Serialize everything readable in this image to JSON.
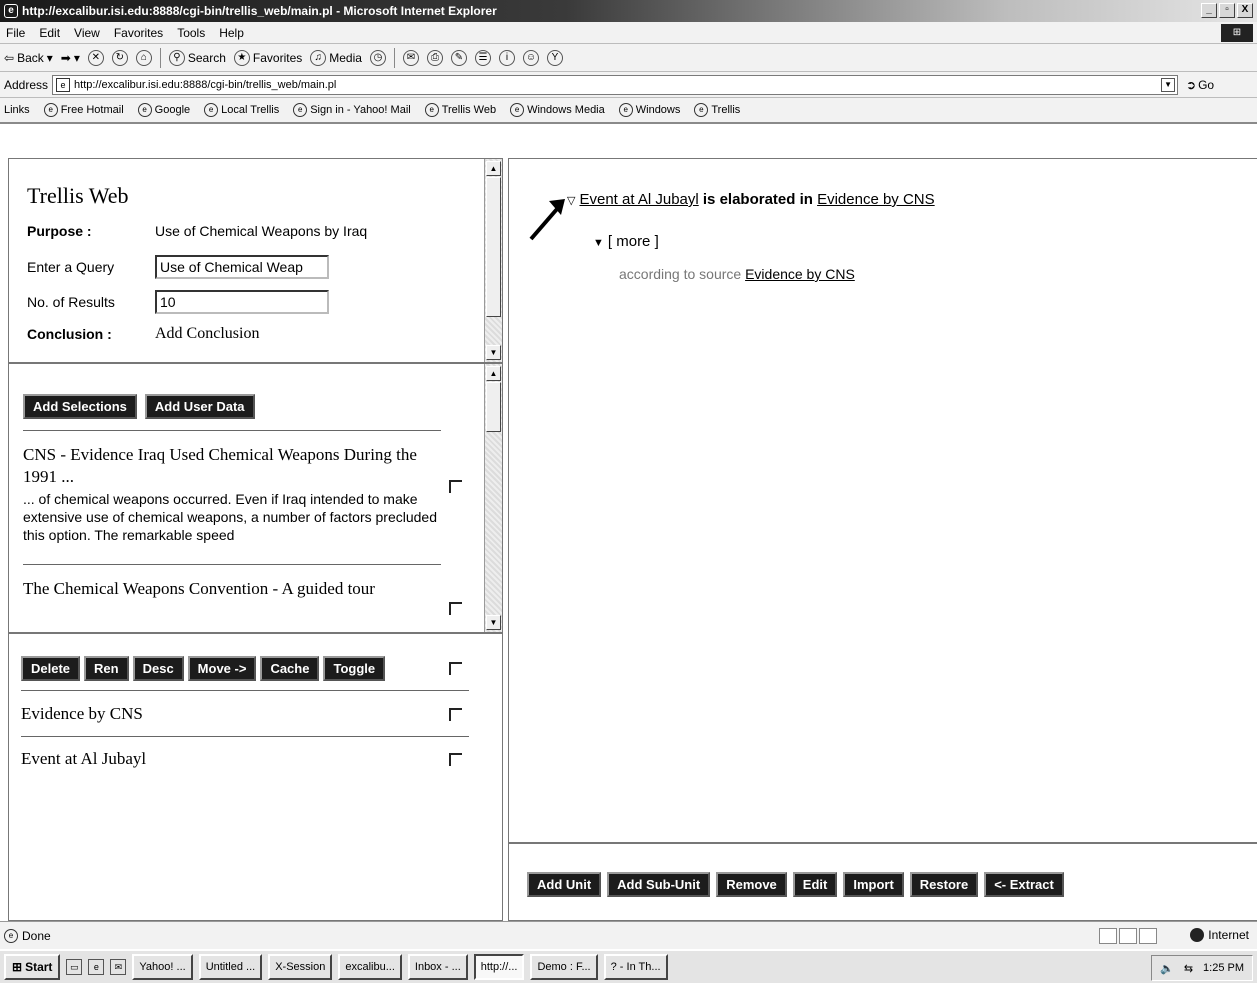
{
  "window": {
    "title": "http://excalibur.isi.edu:8888/cgi-bin/trellis_web/main.pl - Microsoft Internet Explorer",
    "buttons": [
      "_",
      "▫",
      "X"
    ]
  },
  "menu": [
    "File",
    "Edit",
    "View",
    "Favorites",
    "Tools",
    "Help"
  ],
  "toolbar": {
    "back": "Back",
    "search": "Search",
    "favorites": "Favorites",
    "media": "Media"
  },
  "address": {
    "label": "Address",
    "url": "http://excalibur.isi.edu:8888/cgi-bin/trellis_web/main.pl",
    "go": "Go"
  },
  "links": {
    "label": "Links",
    "items": [
      "Free Hotmail",
      "Google",
      "Local Trellis",
      "Sign in - Yahoo! Mail",
      "Trellis Web",
      "Windows Media",
      "Windows",
      "Trellis"
    ]
  },
  "query_frame": {
    "brand": "Trellis Web",
    "purpose_label": "Purpose :",
    "purpose_value": "Use of Chemical Weapons by Iraq",
    "query_label": "Enter a Query",
    "query_value": "Use of Chemical Weap",
    "results_label": "No. of Results",
    "results_value": "10",
    "conclusion_label": "Conclusion :",
    "conclusion_value": "Add Conclusion"
  },
  "results_frame": {
    "add_selections": "Add Selections",
    "add_user_data": "Add User Data",
    "results": [
      {
        "title": "CNS - Evidence Iraq Used Chemical Weapons During the 1991 ...",
        "snippet": "... of chemical weapons occurred. Even if Iraq intended to make extensive use of chemical weapons, a number of factors precluded this option. The remarkable speed"
      },
      {
        "title": "The Chemical Weapons Convention - A guided tour",
        "snippet": ""
      }
    ]
  },
  "units_frame": {
    "buttons": [
      "Delete",
      "Ren",
      "Desc",
      "Move ->",
      "Cache",
      "Toggle"
    ],
    "items": [
      "Evidence by CNS",
      "Event at Al Jubayl"
    ]
  },
  "tree": {
    "node_subject": "Event at Al Jubayl",
    "node_relation": " is elaborated in ",
    "node_object": "Evidence by CNS",
    "more": "[ more ]",
    "source_prefix": "according to source ",
    "source_link": "Evidence by CNS"
  },
  "action_buttons": [
    "Add Unit",
    "Add Sub-Unit",
    "Remove",
    "Edit",
    "Import",
    "Restore",
    "<- Extract"
  ],
  "status": {
    "text": "Done",
    "zone": "Internet"
  },
  "taskbar": {
    "start": "Start",
    "tasks": [
      "Yahoo! ...",
      "Untitled ...",
      "X-Session",
      "excalibu...",
      "Inbox - ...",
      "http://...",
      "Demo : F...",
      "? - In Th..."
    ],
    "clock": "1:25 PM"
  }
}
